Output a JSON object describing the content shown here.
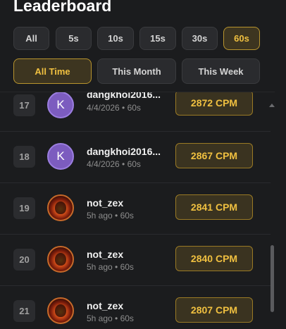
{
  "title": "Leaderboard",
  "duration_filters": [
    "All",
    "5s",
    "10s",
    "15s",
    "30s",
    "60s"
  ],
  "duration_selected": "60s",
  "period_filters": [
    "All Time",
    "This Month",
    "This Week"
  ],
  "period_selected": "All Time",
  "rows": [
    {
      "rank": "17",
      "name": "dangkhoi2016...",
      "meta": "4/4/2026 • 60s",
      "cpm": "2872 CPM",
      "avatar": "K"
    },
    {
      "rank": "18",
      "name": "dangkhoi2016...",
      "meta": "4/4/2026 • 60s",
      "cpm": "2867 CPM",
      "avatar": "K"
    },
    {
      "rank": "19",
      "name": "not_zex",
      "meta": "5h ago • 60s",
      "cpm": "2841 CPM",
      "avatar": "image"
    },
    {
      "rank": "20",
      "name": "not_zex",
      "meta": "5h ago • 60s",
      "cpm": "2840 CPM",
      "avatar": "image"
    },
    {
      "rank": "21",
      "name": "not_zex",
      "meta": "5h ago • 60s",
      "cpm": "2807 CPM",
      "avatar": "image"
    }
  ]
}
